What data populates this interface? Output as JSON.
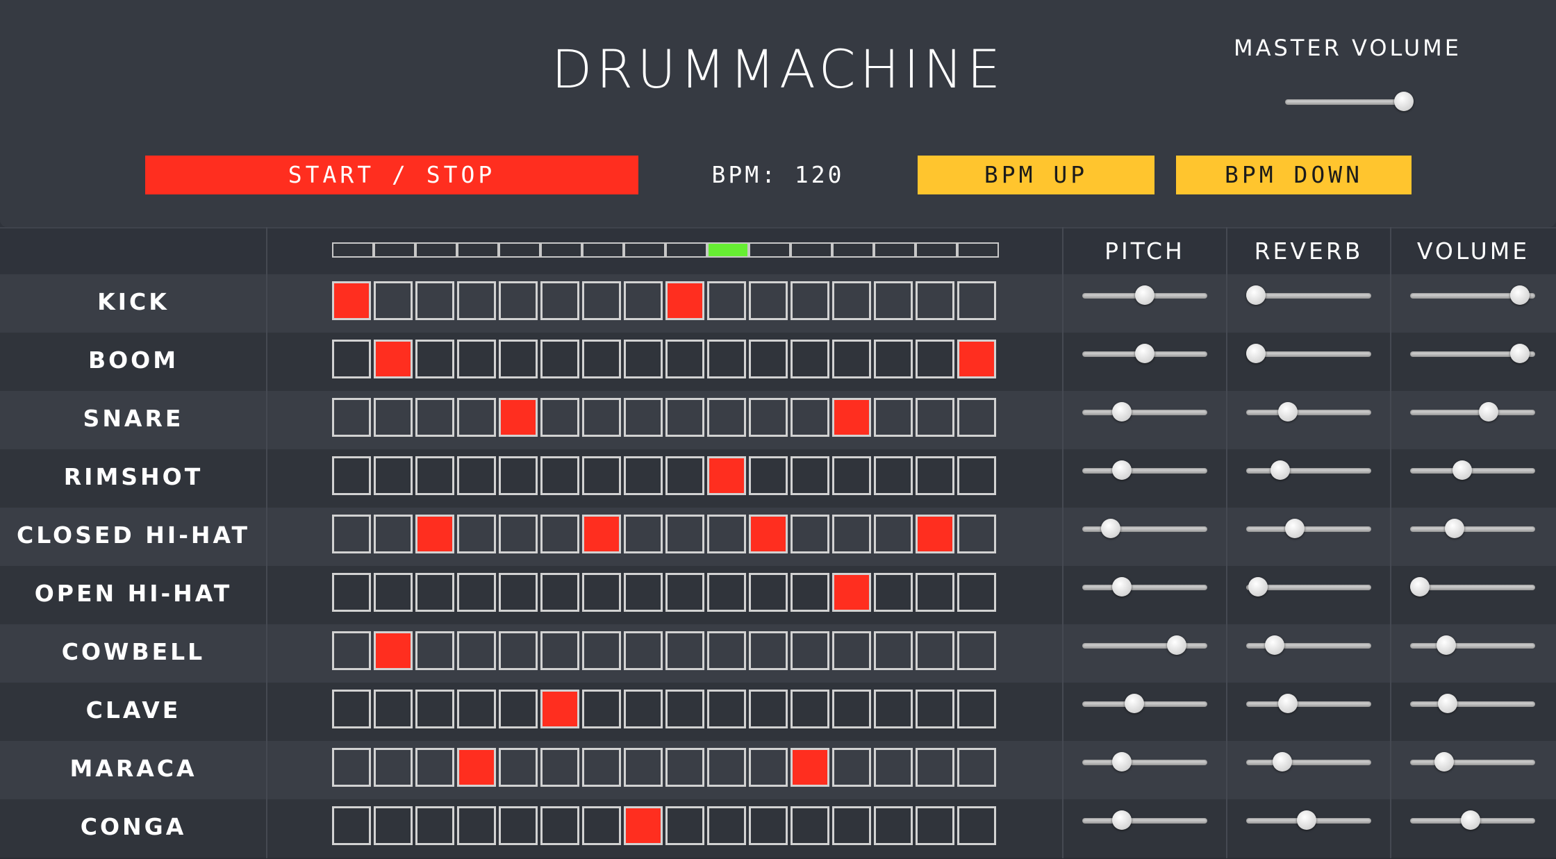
{
  "header": {
    "title": "DRUMMACHINE",
    "master_volume_label": "MASTER VOLUME",
    "master_volume": 0.95,
    "start_stop_label": "START / STOP",
    "bpm_text": "BPM: 120",
    "bpm_up_label": "BPM UP",
    "bpm_down_label": "BPM DOWN"
  },
  "columns": {
    "pitch": "PITCH",
    "reverb": "REVERB",
    "volume": "VOLUME"
  },
  "current_step": 9,
  "colors": {
    "step_on": "#ff2e1f",
    "playhead": "#66ee33",
    "start_button": "#ff2e1f",
    "bpm_buttons": "#ffc52e"
  },
  "tracks": [
    {
      "name": "KICK",
      "steps": [
        1,
        0,
        0,
        0,
        0,
        0,
        0,
        0,
        1,
        0,
        0,
        0,
        0,
        0,
        0,
        0
      ],
      "pitch": 0.5,
      "reverb": 0.0,
      "volume": 0.95
    },
    {
      "name": "BOOM",
      "steps": [
        0,
        1,
        0,
        0,
        0,
        0,
        0,
        0,
        0,
        0,
        0,
        0,
        0,
        0,
        0,
        1
      ],
      "pitch": 0.5,
      "reverb": 0.0,
      "volume": 0.95
    },
    {
      "name": "SNARE",
      "steps": [
        0,
        0,
        0,
        0,
        1,
        0,
        0,
        0,
        0,
        0,
        0,
        0,
        1,
        0,
        0,
        0
      ],
      "pitch": 0.28,
      "reverb": 0.3,
      "volume": 0.65
    },
    {
      "name": "RIMSHOT",
      "steps": [
        0,
        0,
        0,
        0,
        0,
        0,
        0,
        0,
        0,
        1,
        0,
        0,
        0,
        0,
        0,
        0
      ],
      "pitch": 0.28,
      "reverb": 0.23,
      "volume": 0.4
    },
    {
      "name": "CLOSED HI-HAT",
      "steps": [
        0,
        0,
        1,
        0,
        0,
        0,
        1,
        0,
        0,
        0,
        1,
        0,
        0,
        0,
        1,
        0
      ],
      "pitch": 0.18,
      "reverb": 0.37,
      "volume": 0.33
    },
    {
      "name": "OPEN HI-HAT",
      "steps": [
        0,
        0,
        0,
        0,
        0,
        0,
        0,
        0,
        0,
        0,
        0,
        0,
        1,
        0,
        0,
        0
      ],
      "pitch": 0.28,
      "reverb": 0.02,
      "volume": 0.0
    },
    {
      "name": "COWBELL",
      "steps": [
        0,
        1,
        0,
        0,
        0,
        0,
        0,
        0,
        0,
        0,
        0,
        0,
        0,
        0,
        0,
        0
      ],
      "pitch": 0.8,
      "reverb": 0.18,
      "volume": 0.25
    },
    {
      "name": "CLAVE",
      "steps": [
        0,
        0,
        0,
        0,
        0,
        1,
        0,
        0,
        0,
        0,
        0,
        0,
        0,
        0,
        0,
        0
      ],
      "pitch": 0.4,
      "reverb": 0.3,
      "volume": 0.26
    },
    {
      "name": "MARACA",
      "steps": [
        0,
        0,
        0,
        1,
        0,
        0,
        0,
        0,
        0,
        0,
        0,
        1,
        0,
        0,
        0,
        0
      ],
      "pitch": 0.28,
      "reverb": 0.25,
      "volume": 0.23
    },
    {
      "name": "CONGA",
      "steps": [
        0,
        0,
        0,
        0,
        0,
        0,
        0,
        1,
        0,
        0,
        0,
        0,
        0,
        0,
        0,
        0
      ],
      "pitch": 0.28,
      "reverb": 0.48,
      "volume": 0.48
    }
  ]
}
